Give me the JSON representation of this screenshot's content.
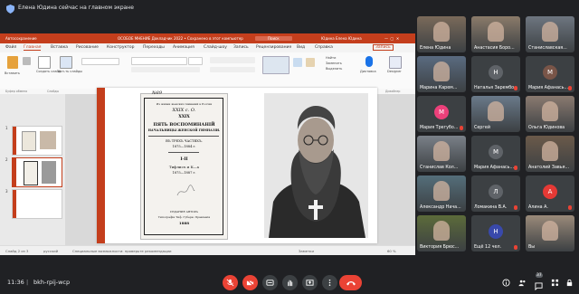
{
  "meet": {
    "presenter_banner": "Елена Юдина сейчас на главном экране",
    "time": "11:36",
    "separator": "|",
    "meeting_code": "bkh-rpij-wcp",
    "participants_count": "37",
    "colors": {
      "bg": "#202124",
      "tile": "#3c4043",
      "danger": "#ea4335",
      "accent": "#c43e1c"
    }
  },
  "ppt": {
    "titlebar": {
      "autosave": "Автосохранение",
      "filename": "ОСОБОЕ МНЕНИЕ Докладчик 2022 • Сохранено в этот компьютер",
      "search": "Поиск",
      "user": "Юдина Елена Юдина"
    },
    "tabs": [
      "Файл",
      "Главная",
      "Вставка",
      "Рисование",
      "Конструктор",
      "Переходы",
      "Анимация",
      "Слайд-шоу",
      "Запись",
      "Рецензирование",
      "Вид",
      "Справка"
    ],
    "share": "Запись",
    "ribbon_labels": {
      "paste": "Вставить",
      "create_slide": "Создать слайд",
      "reuse_slides": "Исп-ть слайды",
      "find": "Найти",
      "replace": "Заменить",
      "select": "Выделить",
      "dictate": "Диктовка",
      "designer": "Designer",
      "editing": "Редактирование"
    },
    "ribbon_groups": [
      "Буфер обмена",
      "Слайды",
      "Шрифт",
      "Абзац",
      "Рисование",
      "Редактирование",
      "Голос",
      "Дизайнер"
    ],
    "slide_numbers": [
      "1",
      "2",
      "3"
    ],
    "status": {
      "slide": "Слайд 2 из 3",
      "language": "русский",
      "accessibility": "Специальные возможности: проверьте рекомендации",
      "notes": "Заметки",
      "zoom": "60 %"
    }
  },
  "document": {
    "corner": "№89",
    "header1": "Из жизни женских гимназий в России",
    "header2": "XXIX с. О.",
    "roman": "XXIX",
    "title_line1": "ПЯТЬ ВОСПОМИНАНІЙ",
    "title_line2": "НАЧАЛЬНИЦЫ ЖЕНСКОЙ ГИМНАЗІИ.",
    "subtitle": "ВЪ ТРЕХЪ ЧАСТЯХЪ.",
    "years1": "1875—1884 г.",
    "part": "I-II",
    "city_line": "Тифлисъ и К—а",
    "years2": "1875—1887 г.",
    "publisher_line1": "ИЗДАНИЕ АВТОРА",
    "publisher_line2": "Типографія Тиф. Губерн. Правленія",
    "year": "1888"
  },
  "participants": [
    {
      "name": "Елена Юдина",
      "avatar": "",
      "color": "#7a6a5a",
      "has_video": true
    },
    {
      "name": "Анастасия Боро...",
      "avatar": "",
      "color": "#8b7b6a",
      "has_video": true
    },
    {
      "name": "Станиславская...",
      "avatar": "",
      "color": "#6e7680",
      "has_video": true
    },
    {
      "name": "Марина Карем...",
      "avatar": "",
      "color": "#5a6b80",
      "has_video": true
    },
    {
      "name": "Наталья Зарембо",
      "avatar": "Н",
      "color": "#5f6368",
      "has_video": false
    },
    {
      "name": "Мария Афанась...",
      "avatar": "М",
      "color": "#795548",
      "has_video": false
    },
    {
      "name": "Мария Трегубо...",
      "avatar": "М",
      "color": "#ec407a",
      "has_video": false
    },
    {
      "name": "Сергей",
      "avatar": "",
      "color": "#6a7a8a",
      "has_video": true
    },
    {
      "name": "Ольга Юдинова",
      "avatar": "",
      "color": "#8a7a70",
      "has_video": true
    },
    {
      "name": "Станислав Кол...",
      "avatar": "",
      "color": "#7a8088",
      "has_video": true
    },
    {
      "name": "Мария Афанась...",
      "avatar": "М",
      "color": "#5f6368",
      "has_video": false
    },
    {
      "name": "Анатолий Завья...",
      "avatar": "",
      "color": "#6b5a4a",
      "has_video": true
    },
    {
      "name": "Александр Нача...",
      "avatar": "",
      "color": "#546e7a",
      "has_video": true
    },
    {
      "name": "Ломакина В.А.",
      "avatar": "Л",
      "color": "#5f6368",
      "has_video": false
    },
    {
      "name": "Алина А.",
      "avatar": "А",
      "color": "#e53935",
      "has_video": false
    },
    {
      "name": "Виктория Брюс...",
      "avatar": "",
      "color": "#5c6b3a",
      "has_video": true
    },
    {
      "name": "Ещё 12 чел.",
      "avatar": "Н",
      "color": "#3949ab",
      "has_video": false
    },
    {
      "name": "Вы",
      "avatar": "",
      "color": "#9a8a7a",
      "has_video": true
    }
  ]
}
